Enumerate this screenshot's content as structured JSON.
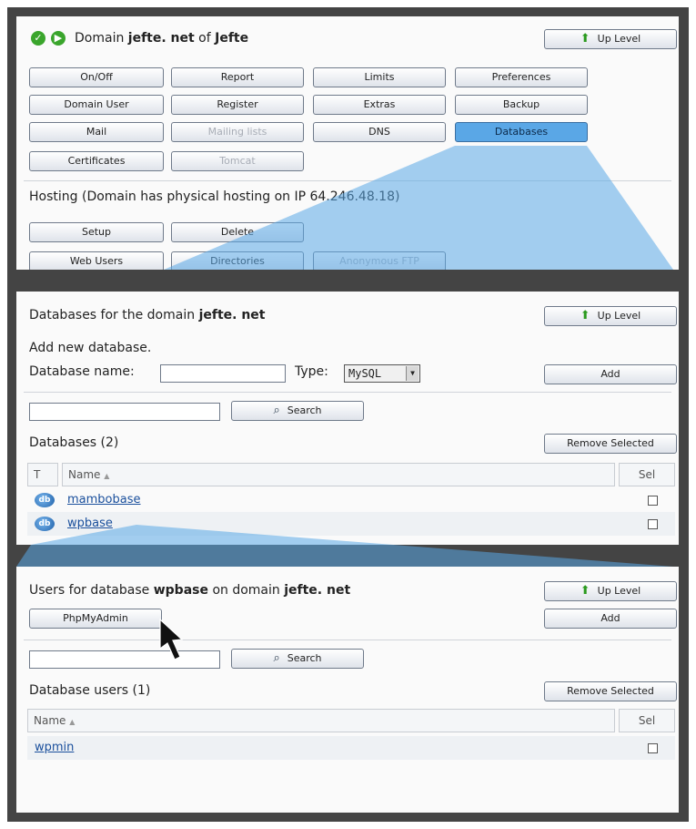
{
  "panel1": {
    "title_prefix": "Domain",
    "domain": "jefte. net",
    "title_of": "of",
    "owner": "Jefte",
    "up_level": "Up Level",
    "buttons": [
      "On/Off",
      "Report",
      "Limits",
      "Preferences",
      "Domain User",
      "Register",
      "Extras",
      "Backup",
      "Mail",
      "Mailing lists",
      "DNS",
      "Databases",
      "Certificates",
      "Tomcat"
    ],
    "hosting_text": "Hosting (Domain has physical hosting on IP 64.246.48.18)",
    "hosting_buttons": [
      "Setup",
      "Delete",
      "Web Users",
      "Directories",
      "Anonymous FTP"
    ]
  },
  "panel2": {
    "title_prefix": "Databases for the domain",
    "domain": "jefte. net",
    "up_level": "Up Level",
    "add_new": "Add new database.",
    "db_name_label": "Database name:",
    "type_label": "Type:",
    "type_value": "MySQL",
    "add_label": "Add",
    "search_label": "Search",
    "list_title": "Databases (2)",
    "remove_selected": "Remove Selected",
    "col_t": "T",
    "col_name": "Name",
    "col_sel": "Sel",
    "rows": [
      "mambobase",
      "wpbase"
    ]
  },
  "panel3": {
    "title_prefix": "Users for database",
    "database": "wpbase",
    "title_on": "on domain",
    "domain": "jefte. net",
    "up_level": "Up Level",
    "phpmyadmin": "PhpMyAdmin",
    "add_label": "Add",
    "search_label": "Search",
    "list_title": "Database users (1)",
    "remove_selected": "Remove Selected",
    "col_name": "Name",
    "col_sel": "Sel",
    "rows": [
      "wpmin"
    ]
  },
  "colors": {
    "frame": "#444444",
    "highlight": "#5aa7e6",
    "link": "#1a4f9c"
  }
}
